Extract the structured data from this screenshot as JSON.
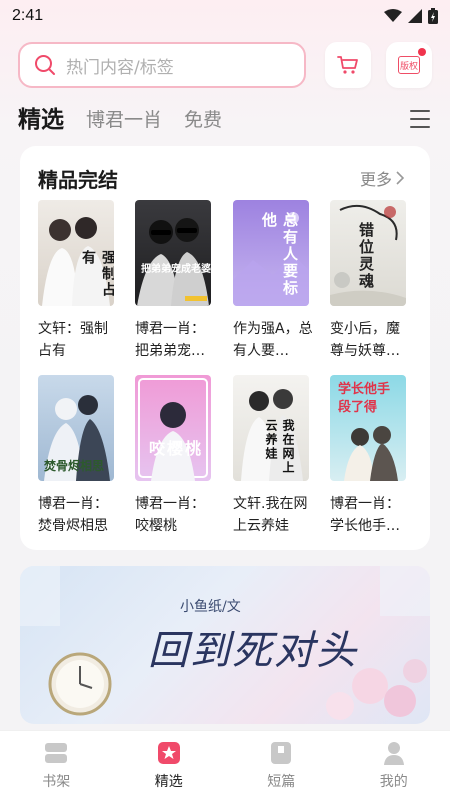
{
  "status": {
    "time": "2:41"
  },
  "search": {
    "placeholder": "热门内容/标签"
  },
  "header": {
    "rights_label": "版权"
  },
  "tabs": [
    {
      "label": "精选",
      "active": true
    },
    {
      "label": "博君一肖",
      "active": false
    },
    {
      "label": "免费",
      "active": false
    }
  ],
  "section": {
    "title": "精品完结",
    "more_label": "更多",
    "books": [
      {
        "title": "文轩：强制占有",
        "cover_text": "强制占有",
        "cover_color": "#e9e4de"
      },
      {
        "title": "博君一肖：把弟弟宠…",
        "cover_text": "把弟弟宠成老婆",
        "cover_color": "#2b2b2e"
      },
      {
        "title": "作为强A，总有人要…",
        "cover_text": "总有人要标他",
        "cover_color": "#a58be0"
      },
      {
        "title": "变小后，魔尊与妖尊…",
        "cover_text": "错位灵魂",
        "cover_color": "#e7e6e1"
      },
      {
        "title": "博君一肖：焚骨烬相思",
        "cover_text": "焚骨烬相思",
        "cover_color": "#b9cde0"
      },
      {
        "title": "博君一肖：咬樱桃",
        "cover_text": "咬樱桃",
        "cover_color": "#e9a6d6"
      },
      {
        "title": "文轩.我在网上云养娃",
        "cover_text": "我在网上云养娃",
        "cover_color": "#f0efec"
      },
      {
        "title": "博君一肖：学长他手…",
        "cover_text": "学长他手段了得",
        "cover_color": "#8fd6e3"
      }
    ]
  },
  "banner": {
    "author": "小鱼纸/文",
    "title": "回到死对头"
  },
  "bottom_nav": [
    {
      "label": "书架",
      "icon": "bookshelf-icon",
      "active": false
    },
    {
      "label": "精选",
      "icon": "featured-icon",
      "active": true
    },
    {
      "label": "短篇",
      "icon": "short-story-icon",
      "active": false
    },
    {
      "label": "我的",
      "icon": "profile-icon",
      "active": false
    }
  ],
  "colors": {
    "accent": "#f04a6a",
    "search_border": "#f6b8c6"
  }
}
